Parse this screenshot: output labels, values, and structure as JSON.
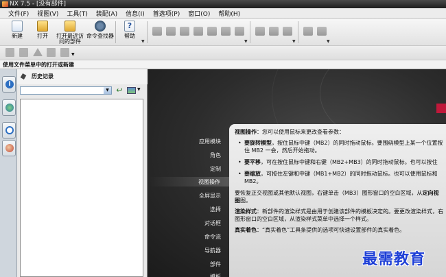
{
  "window": {
    "title": "NX 7.5 - [没有部件]"
  },
  "menu": [
    "文件(F)",
    "视图(V)",
    "工具(T)",
    "装配(A)",
    "信息(I)",
    "首选项(P)",
    "窗口(O)",
    "帮助(H)"
  ],
  "toolbar": {
    "new_label": "新建",
    "open_label": "打开",
    "recent_label": "打开最近访问的部件",
    "finder_label": "命令查找器",
    "help_label": "帮助"
  },
  "statusbar": {
    "text": "使用文件菜单中的打开或新建"
  },
  "nav": {
    "title": "历史记录",
    "combo_value": ""
  },
  "sidebar_items": [
    "应用模块",
    "角色",
    "定制",
    "视图操作",
    "全屏显示",
    "选择",
    "对话框",
    "命令流",
    "导航器",
    "部件",
    "模板"
  ],
  "active_item": "视图操作",
  "panel": {
    "intro_label": "视图操作",
    "intro_text": "：您可以使用鼠标来更改查看参数：",
    "rotate_label": "要旋转模型",
    "rotate_text": "，按住鼠标中键（MB2）的同时拖动鼠标。要围绕模型上某一个位置按住 MB2 一会，然后开始拖动。",
    "pan_label": "要平移",
    "pan_text": "，可在按住鼠标中键和右键（MB2+MB3）的同时拖动鼠标。也可以按住",
    "zoom_label": "要缩放",
    "zoom_text": "，可按住左键和中键（MB1+MB2）的同时拖动鼠标。也可以使用鼠标和 MB2。",
    "orient_text_a": "要恢复正交视图或其他默认视图，右键单击（MB3）图形窗口的空白区域，从",
    "orient_label": "定向视图",
    "orient_text_b": "图。",
    "render_label": "渲染样式",
    "render_text": "：新部件的渲染样式是由用于创建该部件的模板决定的。要更改渲染样式，右图形窗口的空白区域，从渲染样式菜单中选择一个样式。",
    "true_shading_label": "真实着色",
    "true_shading_text": "：“真实着色”工具条提供的选项可快速设置部件的真实着色。"
  },
  "watermark": "最需教育"
}
